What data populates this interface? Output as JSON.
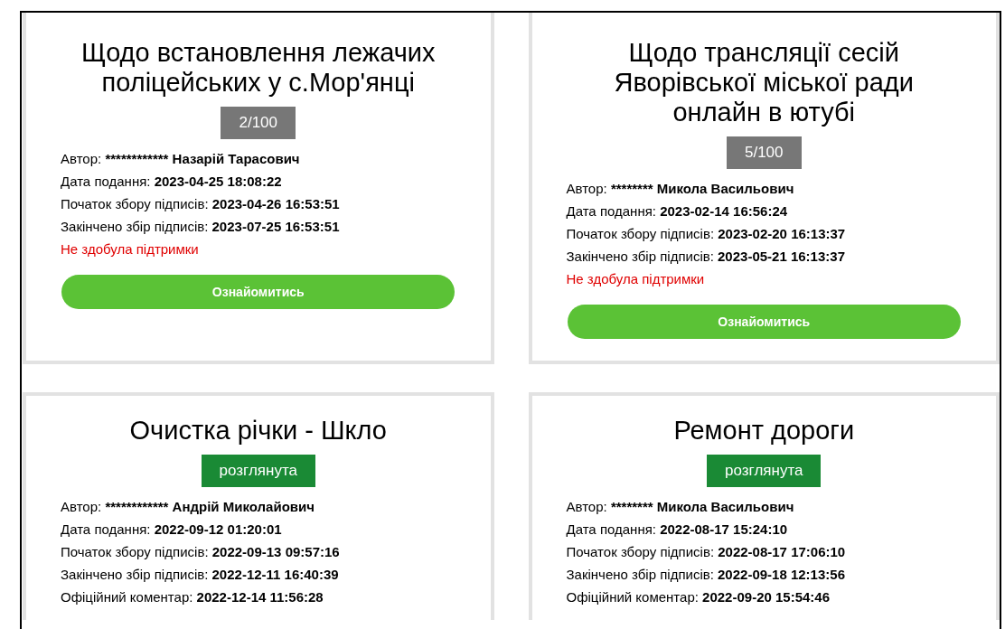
{
  "petitions": [
    {
      "title": "Щодо встановлення лежачих поліцейських у с.Мор'янці",
      "badge": {
        "text": "2/100",
        "kind": "count"
      },
      "fields": [
        {
          "label": "Автор:",
          "value": "************ Назарій Тарасович"
        },
        {
          "label": "Дата подання:",
          "value": "2023-04-25 18:08:22"
        },
        {
          "label": "Початок збору підписів:",
          "value": "2023-04-26 16:53:51"
        },
        {
          "label": "Закінчено збір підписів:",
          "value": "2023-07-25 16:53:51"
        }
      ],
      "status": "Не здобула підтримки",
      "button": "Ознайомитись"
    },
    {
      "title": "Щодо трансляції сесій Яворівської міської ради онлайн в ютубі",
      "badge": {
        "text": "5/100",
        "kind": "count"
      },
      "fields": [
        {
          "label": "Автор:",
          "value": "******** Микола Васильович"
        },
        {
          "label": "Дата подання:",
          "value": "2023-02-14 16:56:24"
        },
        {
          "label": "Початок збору підписів:",
          "value": "2023-02-20 16:13:37"
        },
        {
          "label": "Закінчено збір підписів:",
          "value": "2023-05-21 16:13:37"
        }
      ],
      "status": "Не здобула підтримки",
      "button": "Ознайомитись"
    },
    {
      "title": "Очистка річки - Шкло",
      "badge": {
        "text": "розглянута",
        "kind": "status"
      },
      "fields": [
        {
          "label": "Автор:",
          "value": "************ Андрій Миколайович"
        },
        {
          "label": "Дата подання:",
          "value": "2022-09-12 01:20:01"
        },
        {
          "label": "Початок збору підписів:",
          "value": "2022-09-13 09:57:16"
        },
        {
          "label": "Закінчено збір підписів:",
          "value": "2022-12-11 16:40:39"
        },
        {
          "label": "Офіційний коментар:",
          "value": "2022-12-14 11:56:28"
        }
      ]
    },
    {
      "title": "Ремонт дороги",
      "badge": {
        "text": "розглянута",
        "kind": "status"
      },
      "fields": [
        {
          "label": "Автор:",
          "value": "******** Микола Васильович"
        },
        {
          "label": "Дата подання:",
          "value": "2022-08-17 15:24:10"
        },
        {
          "label": "Початок збору підписів:",
          "value": "2022-08-17 17:06:10"
        },
        {
          "label": "Закінчено збір підписів:",
          "value": "2022-09-18 12:13:56"
        },
        {
          "label": "Офіційний коментар:",
          "value": "2022-09-20 15:54:46"
        }
      ]
    }
  ]
}
